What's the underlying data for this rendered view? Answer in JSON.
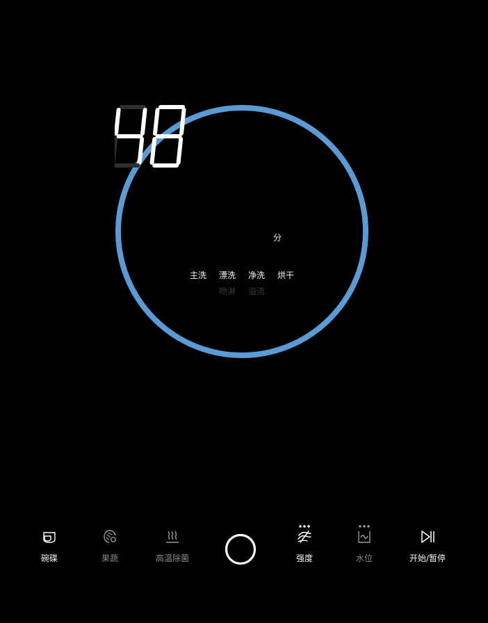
{
  "dial": {
    "ring_color": "#5b9bd5",
    "remaining_time": {
      "digits": [
        "4",
        "8"
      ],
      "unit": "分"
    },
    "stages_primary": [
      {
        "label": "主洗",
        "active": true
      },
      {
        "label": "漂洗",
        "active": true
      },
      {
        "label": "净洗",
        "active": true
      },
      {
        "label": "烘干",
        "active": true
      }
    ],
    "stages_secondary": [
      {
        "label": "喷淋",
        "active": false
      },
      {
        "label": "溢流",
        "active": false
      }
    ]
  },
  "bottom_bar": {
    "bowls": {
      "label": "碗碟",
      "icon": "bowl-icon",
      "active": true
    },
    "fruits": {
      "label": "果蔬",
      "icon": "fruit-icon",
      "active": false
    },
    "sterilize": {
      "label": "高温除菌",
      "icon": "steam-icon",
      "active": false
    },
    "power": {
      "icon": "power-ring-icon"
    },
    "intensity": {
      "label": "强度",
      "icon": "intensity-icon",
      "active": true,
      "has_more": true
    },
    "water_level": {
      "label": "水位",
      "icon": "water-level-icon",
      "active": false,
      "has_more": true
    },
    "start_pause": {
      "label": "开始/暂停",
      "icon": "play-pause-icon",
      "active": true
    }
  }
}
